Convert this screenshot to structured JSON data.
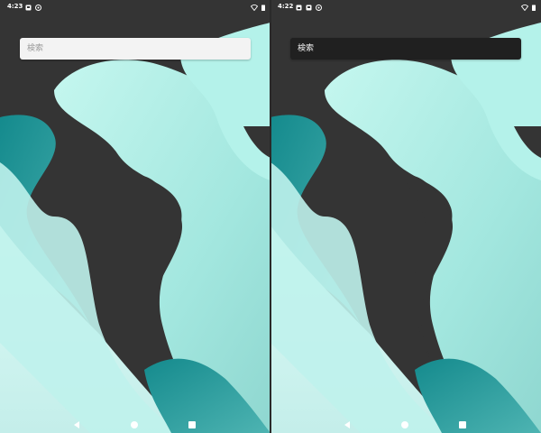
{
  "screens": [
    {
      "status_time": "4:23",
      "search": {
        "placeholder": "検索",
        "theme": "light"
      }
    },
    {
      "status_time": "4:22",
      "search": {
        "placeholder": "検索",
        "theme": "dark"
      }
    }
  ],
  "status_icons": [
    "notification-icon",
    "notification-icon",
    "settings-icon",
    "wifi-icon",
    "battery-icon"
  ],
  "nav_icons": [
    "back-icon",
    "home-icon",
    "recents-icon"
  ],
  "colors": {
    "wallpaper_dark": "#343434",
    "wallpaper_mint": "#a8ece3",
    "wallpaper_teal": "#1c8f92",
    "search_light_bg": "#f3f3f3",
    "search_dark_bg": "#202020"
  }
}
